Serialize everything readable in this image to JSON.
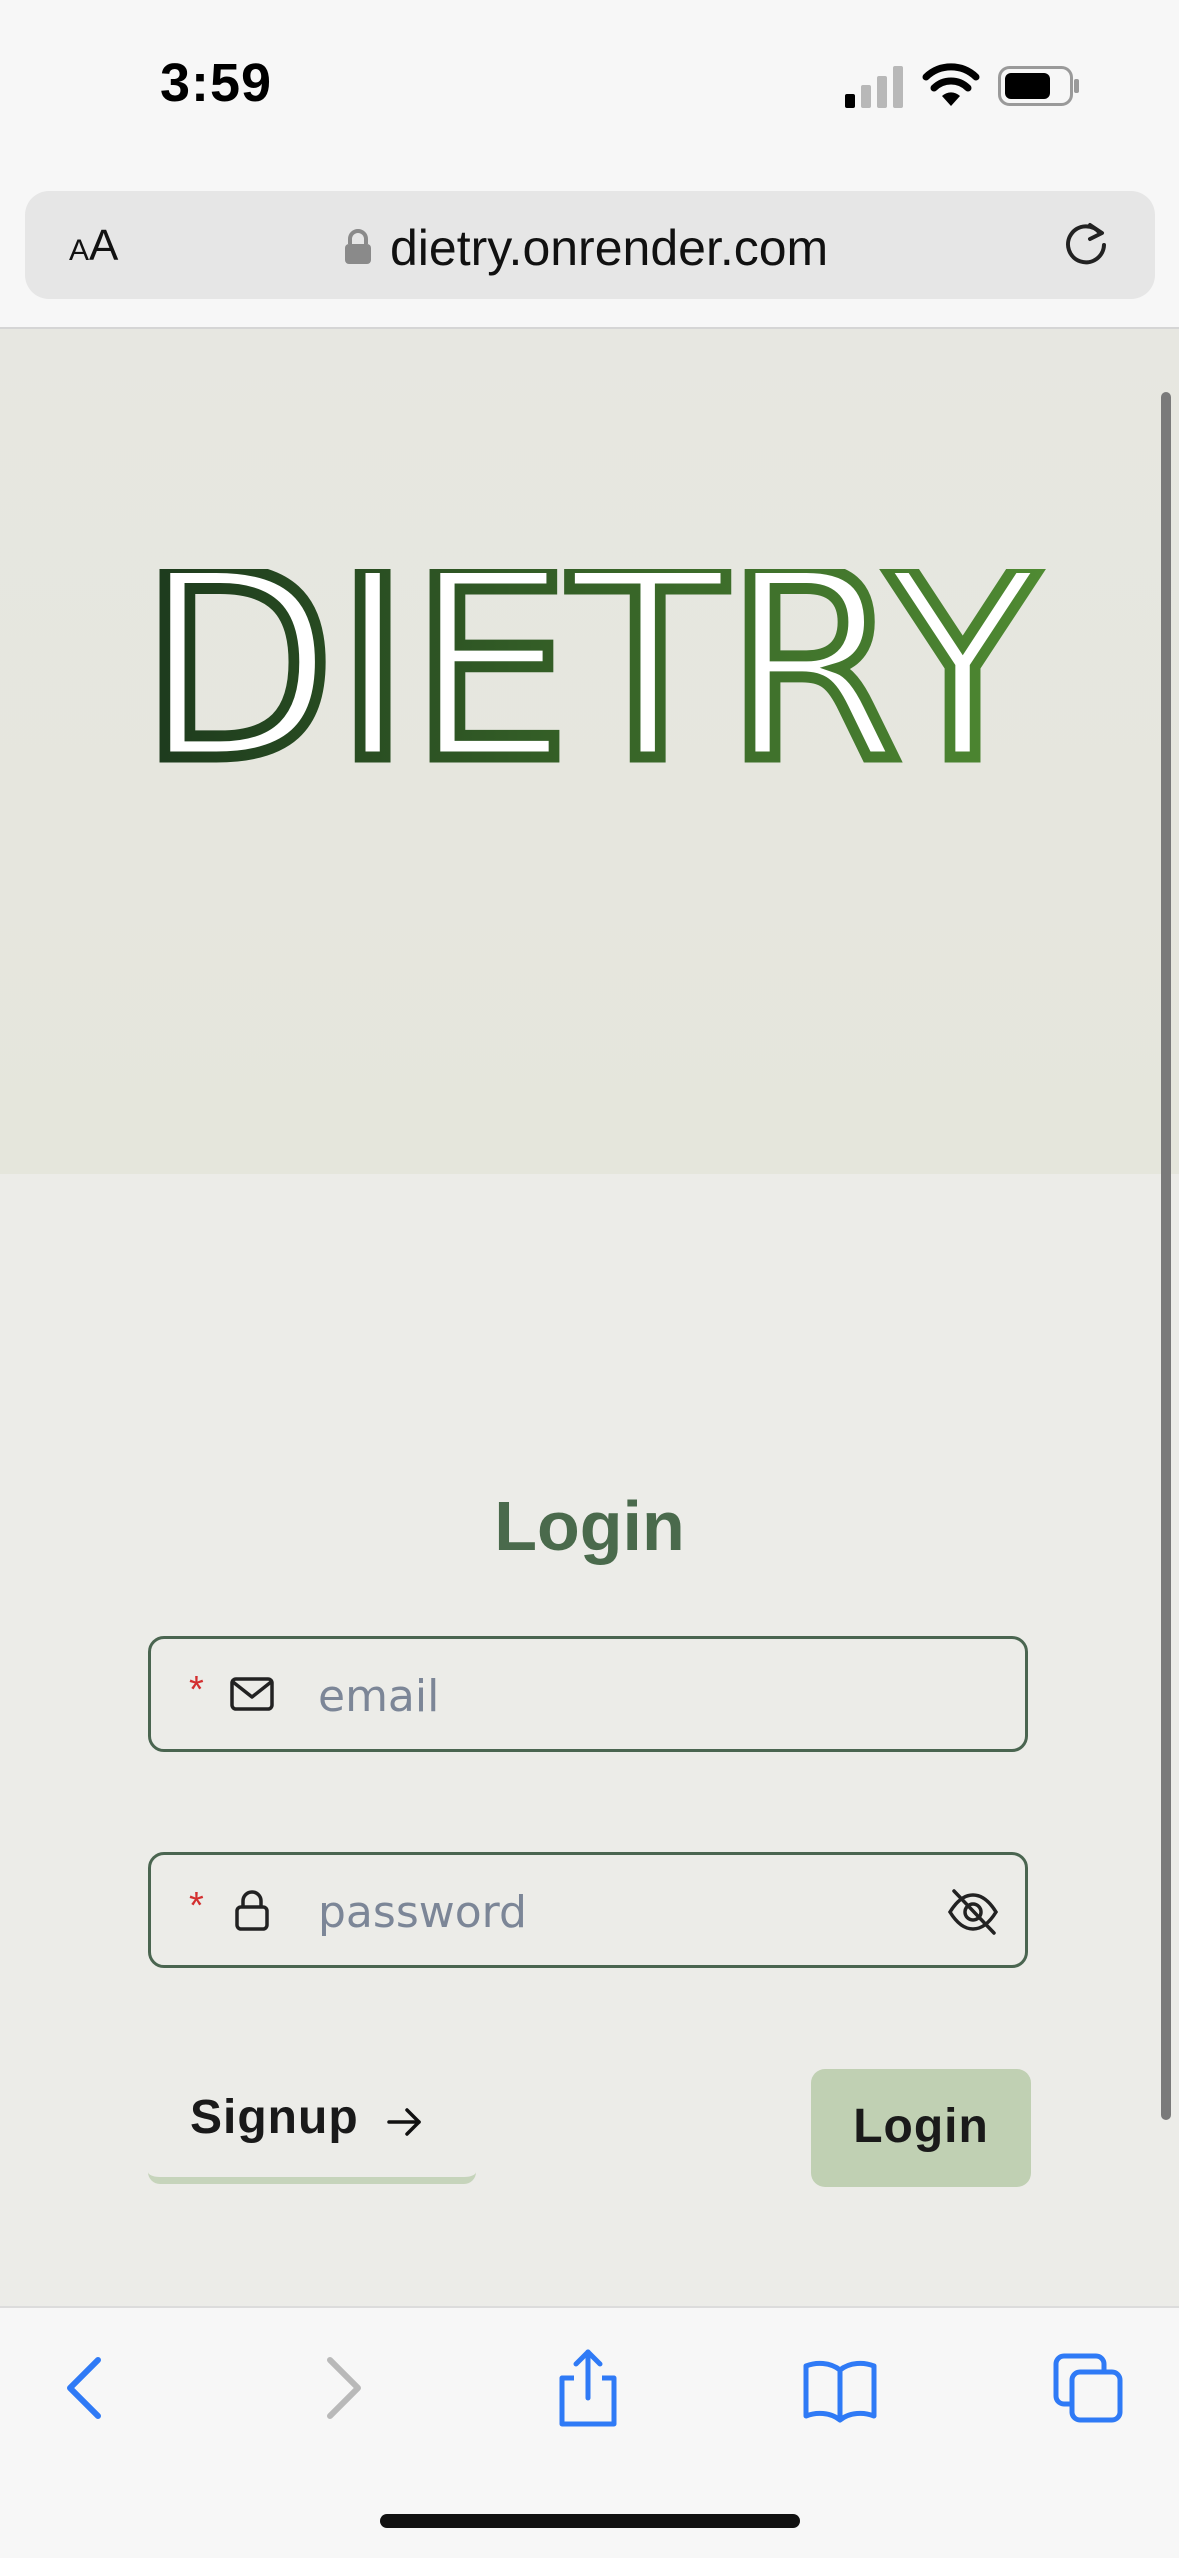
{
  "status_bar": {
    "time": "3:59"
  },
  "browser": {
    "url": "dietry.onrender.com",
    "text_size_label_small": "A",
    "text_size_label_large": "A"
  },
  "hero": {
    "logo_text": "DIETRY"
  },
  "login": {
    "title": "Login",
    "email": {
      "placeholder": "email",
      "required_mark": "*"
    },
    "password": {
      "placeholder": "password",
      "required_mark": "*"
    },
    "signup_label": "Signup",
    "login_label": "Login"
  },
  "colors": {
    "accent": "#4a6a4c",
    "button_bg": "#c0d0b3",
    "required": "#d32f2f",
    "link_blue": "#2f7af6"
  }
}
